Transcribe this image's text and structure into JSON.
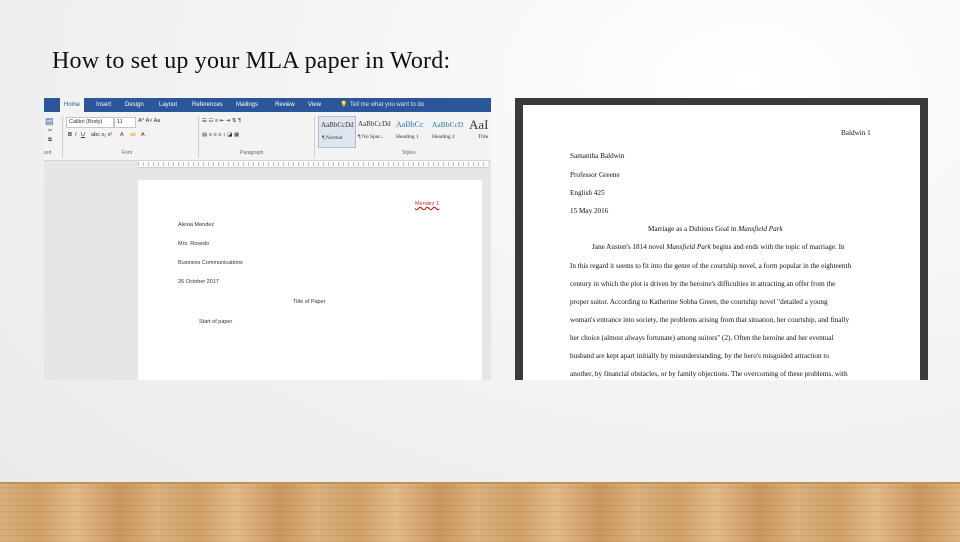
{
  "slide": {
    "title": "How to set up your MLA paper in Word:"
  },
  "word": {
    "tabs": [
      "Home",
      "Insert",
      "Design",
      "Layout",
      "References",
      "Mailings",
      "Review",
      "View"
    ],
    "tell_me": "Tell me what you want to do",
    "font_name": "Calibri (Body)",
    "font_size": "11",
    "groups": {
      "clipboard": "ard",
      "font": "Font",
      "paragraph": "Paragraph",
      "styles": "Styles"
    },
    "styles": [
      {
        "preview": "AaBbCcDd",
        "label": "¶ Normal"
      },
      {
        "preview": "AaBbCcDd",
        "label": "¶ No Spac..."
      },
      {
        "preview": "AaBbCc",
        "label": "Heading 1"
      },
      {
        "preview": "AaBbCcD",
        "label": "Heading 2"
      },
      {
        "preview": "AaI",
        "label": "Title"
      }
    ],
    "doc": {
      "header": "Mendez 1",
      "name": "Alexia Mendez",
      "teacher": "Mrs. Rosedo",
      "class": "Business Communications",
      "date": "26 October 2017",
      "title": "Title of Paper",
      "body": "Start of paper"
    }
  },
  "mla": {
    "header": "Baldwin 1",
    "name": "Samantha Baldwin",
    "professor": "Professor Greene",
    "course": "English 425",
    "date": "15 May 2016",
    "title_pre": "Marriage as a Dubious Goal in ",
    "title_italic": "Mansfield Park",
    "lines": [
      "In this regard it seems to fit into the genre of the courtship novel, a form popular in the eighteenth",
      "century in which the plot is driven by the heroine's difficulties in attracting an offer from the",
      "proper suitor. According to Katherine Sobba Green, the courtship novel \"detailed a young",
      "woman's entrance into society, the problems arising from that situation, her courtship, and finally",
      "her choice (almost always fortunate) among suitors\" (2). Often the heroine and her eventual",
      "husband are kept apart initially by misunderstanding, by the hero's misguided attraction to",
      "another, by financial obstacles, or by family objections. The overcoming of these problems, with"
    ],
    "para1_a": "Jane Austen's 1814 novel ",
    "para1_italic": "Mansfield Park",
    "para1_b": " begins and ends with the topic of marriage. In"
  }
}
